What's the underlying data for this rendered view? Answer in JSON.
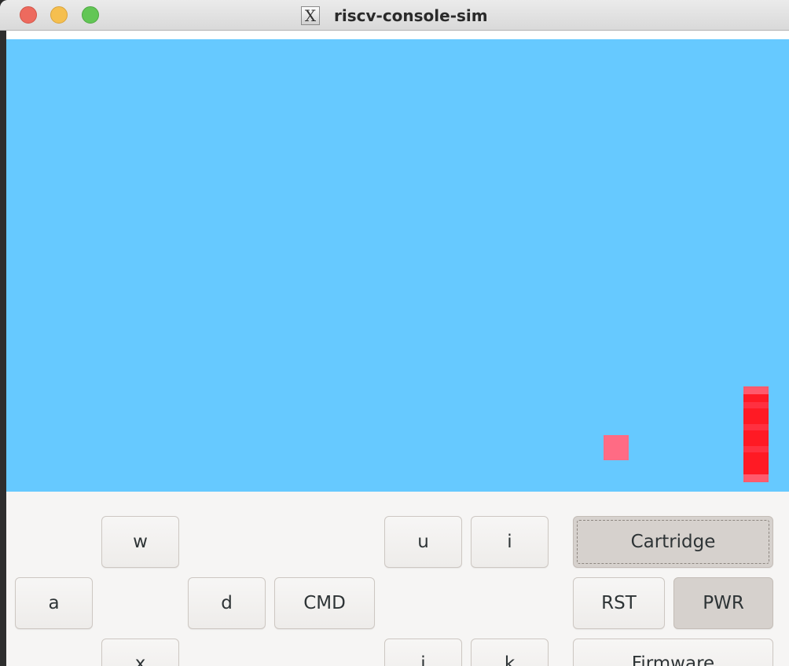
{
  "window": {
    "title": "riscv-console-sim",
    "app_icon": "x11-icon"
  },
  "screen": {
    "background_color": "#66c9ff",
    "ball_color": "#ff6b84",
    "paddle_color": "#ff1a24"
  },
  "controls": {
    "w": "w",
    "a": "a",
    "d": "d",
    "x": "x",
    "cmd": "CMD",
    "u": "u",
    "i": "i",
    "j": "j",
    "k": "k",
    "cartridge": "Cartridge",
    "rst": "RST",
    "pwr": "PWR",
    "firmware": "Firmware"
  }
}
